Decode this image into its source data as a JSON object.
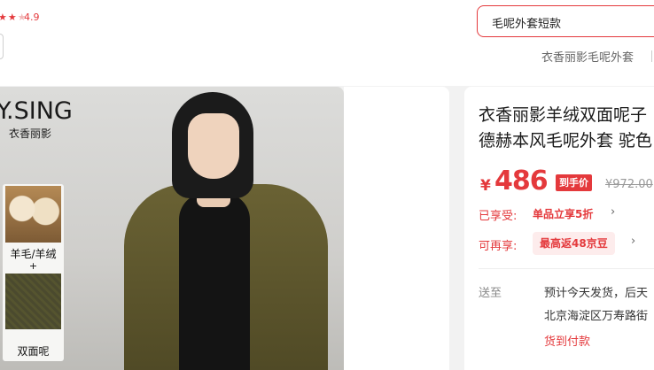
{
  "header": {
    "rating": "4.9",
    "search_value": "毛呢外套短款",
    "hot_keyword": "衣香丽影毛呢外套"
  },
  "gallery": {
    "brand_logo_text": "Y.SING",
    "brand_name_cn": "衣香丽影",
    "feature_material_label": "羊毛/羊绒",
    "feature_plus": "+",
    "feature_fabric_label": "双面呢"
  },
  "product": {
    "title_line1": "衣香丽影羊绒双面呢子",
    "title_line2": "德赫本风毛呢外套 驼色",
    "currency": "¥",
    "price": "486",
    "price_badge": "到手价",
    "original_price": "¥972.00",
    "promo_label": "已享受:",
    "promo_value": "单品立享5折",
    "extra_label": "可再享:",
    "extra_value": "最高返48京豆",
    "ship_label": "送至",
    "ship_line1": "预计今天发货，后天",
    "ship_line2": "北京海淀区万寿路街",
    "ship_line3": "货到付款"
  },
  "colors": {
    "accent": "#e4393c"
  }
}
